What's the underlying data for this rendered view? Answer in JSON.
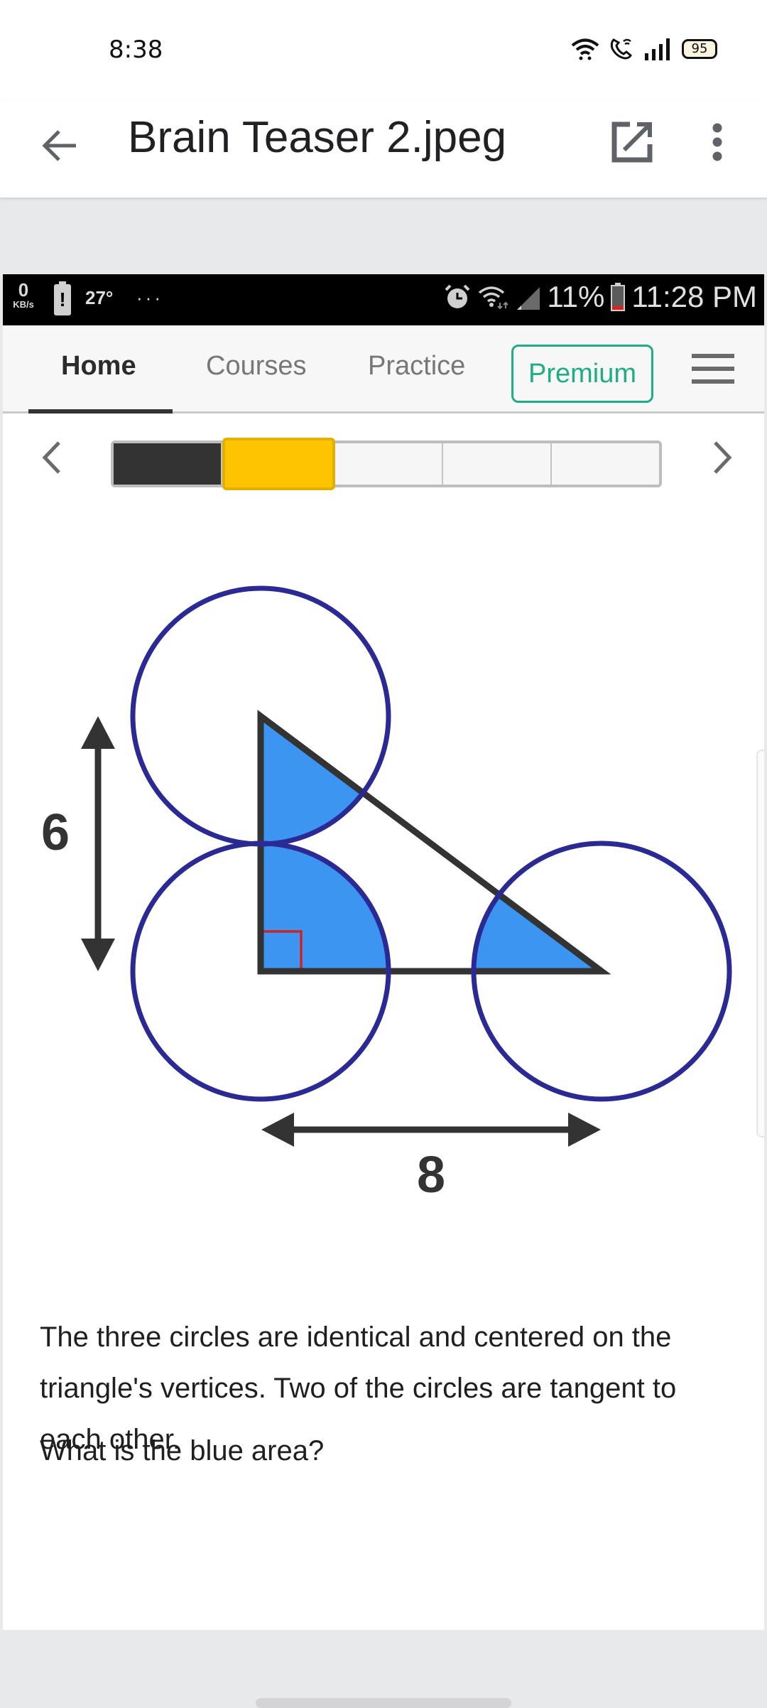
{
  "device_status": {
    "time": "8:38",
    "battery": "95",
    "icons": [
      "wifi-icon",
      "wifi-calling-icon",
      "signal-icon",
      "battery-icon"
    ]
  },
  "app_bar": {
    "title": "Brain Teaser 2.jpeg",
    "back_icon": "arrow-left-icon",
    "open_icon": "open-in-new-icon",
    "more_icon": "more-vert-icon"
  },
  "screenshot": {
    "status": {
      "speed_value": "0",
      "speed_unit": "KB/s",
      "battery_alert": "!",
      "temperature": "27°",
      "more": "···",
      "battery_percent": "11%",
      "clock": "11:28 PM"
    },
    "nav": {
      "tabs": [
        {
          "label": "Home",
          "active": true
        },
        {
          "label": "Courses",
          "active": false
        },
        {
          "label": "Practice",
          "active": false
        }
      ],
      "premium_label": "Premium",
      "menu_icon": "hamburger-icon",
      "accent_color": "#1fad83"
    },
    "progress": {
      "total_steps": 5,
      "completed_steps": 1,
      "current_step": 2,
      "prev_icon": "chevron-left-icon",
      "next_icon": "chevron-right-icon",
      "done_color": "#333333",
      "current_color": "#ffc400"
    },
    "diagram": {
      "height_label": "6",
      "base_label": "8",
      "circle_color": "#2b2a95",
      "shade_color": "#3d95f2",
      "right_angle_color": "#d02020"
    },
    "problem_text": "The three circles are identical and centered on the triangle's vertices. Two of the circles are tangent to each other.",
    "question_text": "What is the blue area?"
  }
}
